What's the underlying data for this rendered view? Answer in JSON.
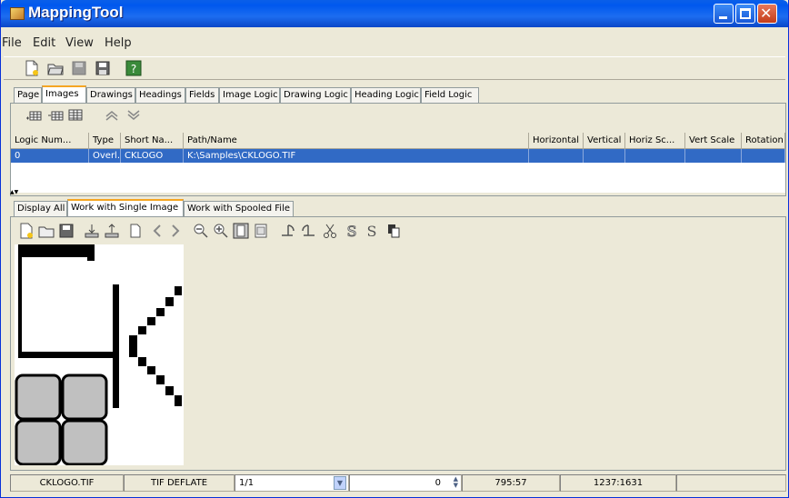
{
  "window": {
    "title": "MappingTool"
  },
  "menu": {
    "file": "File",
    "edit": "Edit",
    "view": "View",
    "help": "Help"
  },
  "tabs": [
    "Page",
    "Images",
    "Drawings",
    "Headings",
    "Fields",
    "Image Logic",
    "Drawing Logic",
    "Heading Logic",
    "Field Logic"
  ],
  "active_tab": "Images",
  "table": {
    "headers": [
      "Logic Num...",
      "Type",
      "Short Na...",
      "Path/Name",
      "Horizontal",
      "Vertical",
      "Horiz Sc...",
      "Vert Scale",
      "Rotation"
    ],
    "rows": [
      {
        "logic_num": "0",
        "type": "Overl...",
        "short_name": "CKLOGO",
        "path": "K:\\Samples\\CKLOGO.TIF",
        "horizontal": "",
        "vertical": "",
        "horiz_scale": "",
        "vert_scale": "",
        "rotation": ""
      }
    ]
  },
  "subtabs": [
    "Display All",
    "Work with Single Image",
    "Work with Spooled File"
  ],
  "active_subtab": "Work with Single Image",
  "statusbar": {
    "file": "CKLOGO.TIF",
    "compression": "TIF DEFLATE",
    "page": "1/1",
    "spinner_value": "0",
    "coords": "795:57",
    "size": "1237:1631"
  },
  "colors": {
    "selection": "#316ac5",
    "title_bar": "#0058ee",
    "active_tab_accent": "#f5a623"
  }
}
